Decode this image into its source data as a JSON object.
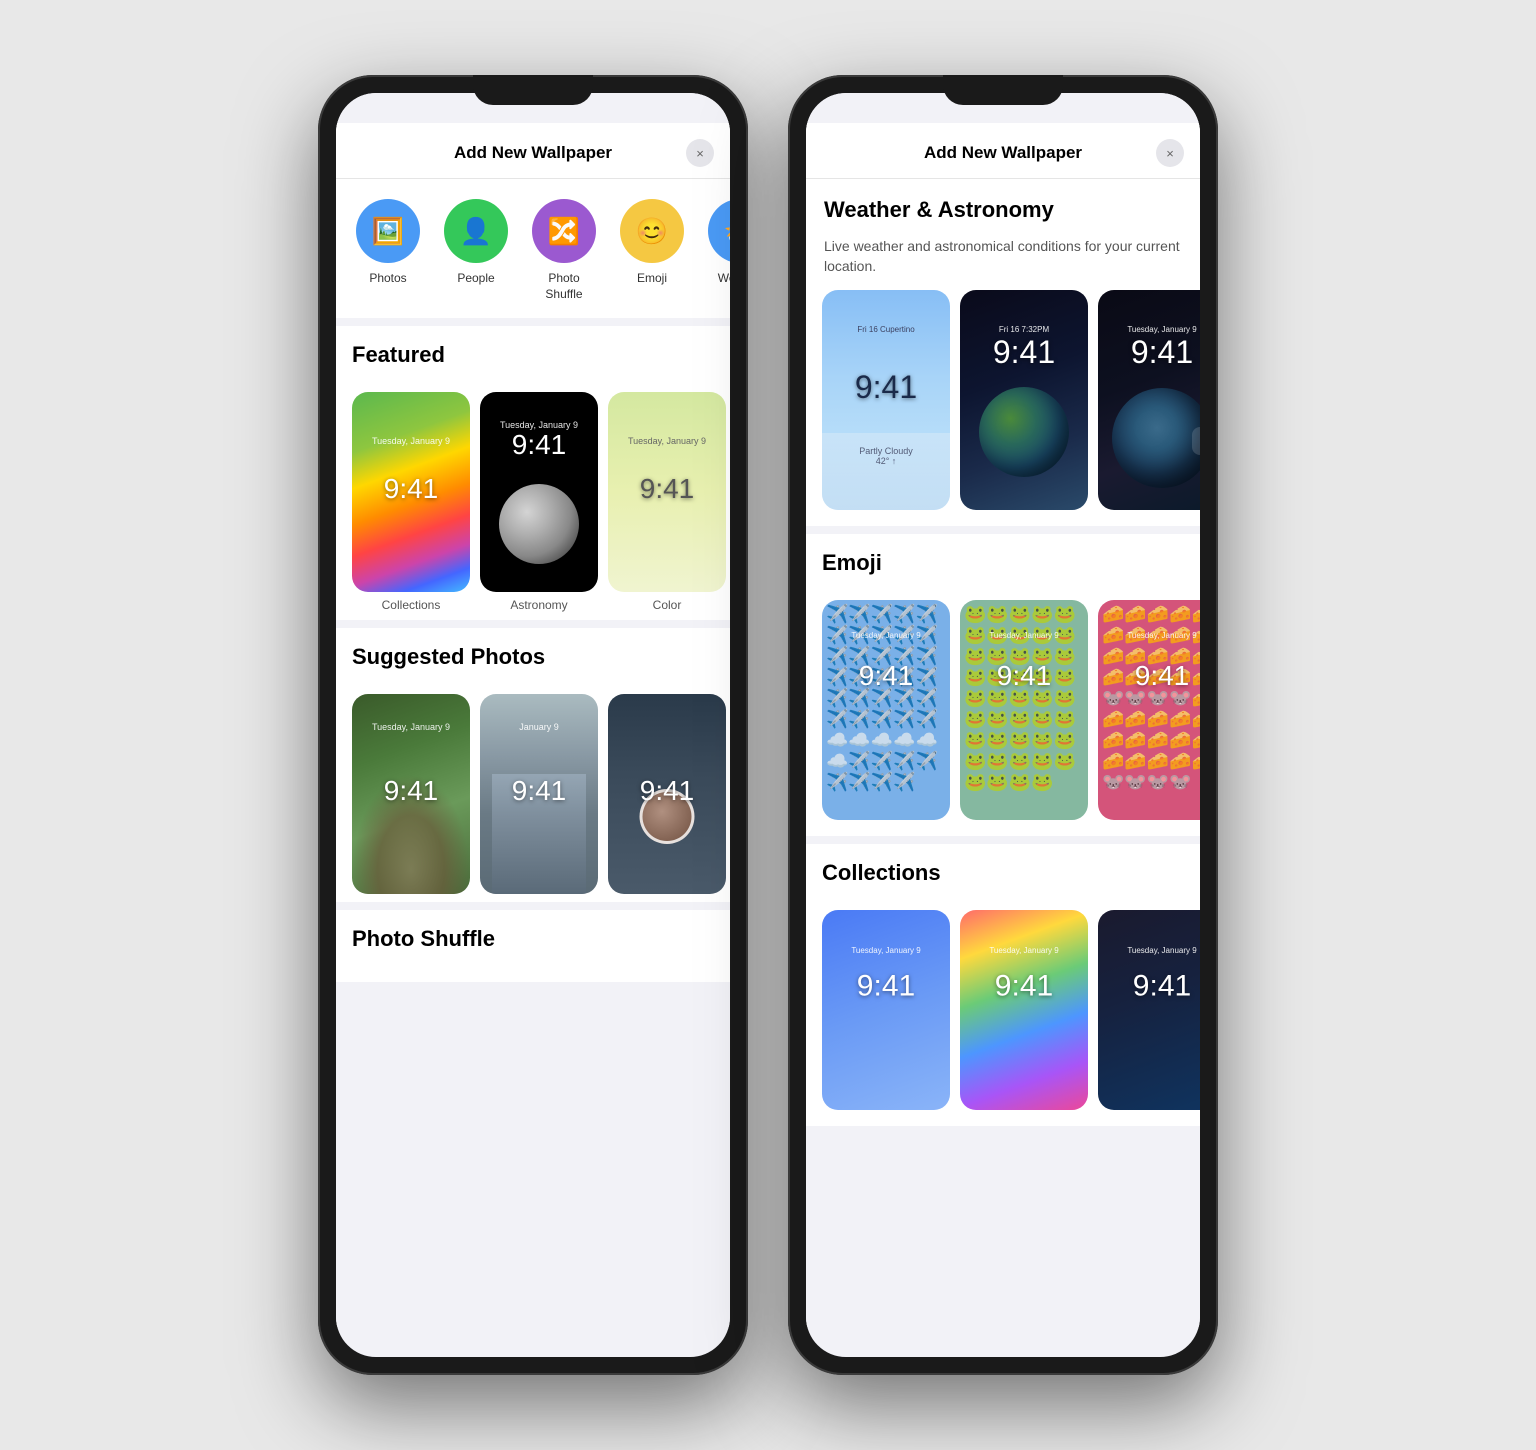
{
  "phones": {
    "left": {
      "title": "Add New Wallpaper",
      "close_label": "×",
      "types": [
        {
          "id": "photos",
          "label": "Photos",
          "icon": "🖼️",
          "color": "#4a9af5"
        },
        {
          "id": "people",
          "label": "People",
          "icon": "👤",
          "color": "#34c85a"
        },
        {
          "id": "photo-shuffle",
          "label": "Photo Shuffle",
          "icon": "🔀",
          "color": "#9b59d0"
        },
        {
          "id": "emoji",
          "label": "Emoji",
          "icon": "😊",
          "color": "#f5c842"
        },
        {
          "id": "weather",
          "label": "Weath...",
          "icon": "⛅",
          "color": "#4a9af5"
        }
      ],
      "featured_title": "Featured",
      "featured_items": [
        {
          "label": "Collections",
          "type": "rainbow",
          "time": "9:41",
          "date": "Tuesday, January 9"
        },
        {
          "label": "Astronomy",
          "type": "moon",
          "time": "9:41",
          "date": "Tuesday, January 9"
        },
        {
          "label": "Color",
          "type": "color",
          "time": "9:41",
          "date": "Tuesday, January 9"
        }
      ],
      "suggested_title": "Suggested Photos",
      "suggested_items": [
        {
          "label": "",
          "type": "cat",
          "time": "9:41",
          "date": "Tuesday, January 9"
        },
        {
          "label": "",
          "type": "building",
          "time": "9:41",
          "date": "January 9"
        },
        {
          "label": "",
          "type": "person",
          "time": "9:41",
          "date": ""
        }
      ],
      "bottom_label": "Photo Shuffle"
    },
    "right": {
      "title": "Add New Wallpaper",
      "close_label": "×",
      "section_title": "Weather & Astronomy",
      "section_desc": "Live weather and astronomical conditions for your current location.",
      "weather_items": [
        {
          "label": "",
          "type": "sky",
          "time": "9:41",
          "date": "Fri 16  Cupertino"
        },
        {
          "label": "",
          "type": "earth",
          "time": "9:41",
          "date": "Fri 16  7:32PM"
        },
        {
          "label": "",
          "type": "earth2",
          "time": "9:41",
          "date": "Tuesday, January 9"
        }
      ],
      "emoji_title": "Emoji",
      "emoji_items": [
        {
          "label": "",
          "type": "emoji-blue",
          "time": "9:41",
          "emojis": "✈️"
        },
        {
          "label": "",
          "type": "emoji-green",
          "time": "9:41",
          "emojis": "🐸"
        },
        {
          "label": "",
          "type": "emoji-pink",
          "time": "9:41",
          "emojis": "🧀"
        }
      ],
      "collections_title": "Collections",
      "collections_items": [
        {
          "label": "",
          "type": "coll-blue",
          "time": "9:41",
          "date": "Tuesday, January 9"
        },
        {
          "label": "",
          "type": "coll-rainbow",
          "time": "9:41",
          "date": "Tuesday, January 9"
        },
        {
          "label": "",
          "type": "coll-dark",
          "time": "9:41",
          "date": "Tuesday, January 9"
        }
      ]
    }
  }
}
